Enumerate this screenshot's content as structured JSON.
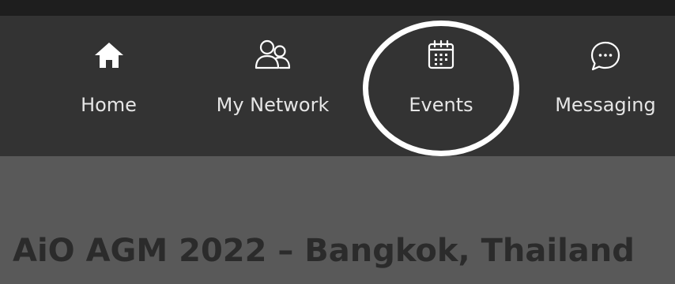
{
  "nav": {
    "items": [
      {
        "id": "home",
        "label": "Home",
        "icon": "home-icon"
      },
      {
        "id": "network",
        "label": "My Network",
        "icon": "people-icon"
      },
      {
        "id": "events",
        "label": "Events",
        "icon": "calendar-icon"
      },
      {
        "id": "messaging",
        "label": "Messaging",
        "icon": "chat-bubble-icon"
      }
    ],
    "highlighted_item": "Events"
  },
  "event": {
    "title": "AiO AGM 2022 – Bangkok, Thailand"
  },
  "colors": {
    "top_strip": "#1e1e1e",
    "navbar_bg": "#333333",
    "nav_text": "#e6e6e6",
    "content_bg": "#595959",
    "title_text": "#2b2b2b",
    "highlight_circle": "#ffffff"
  }
}
